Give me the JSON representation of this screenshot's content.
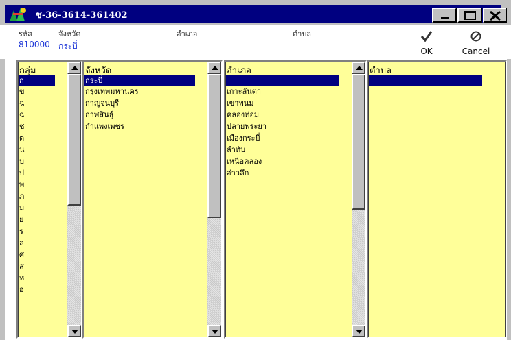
{
  "window": {
    "title": "ช-36-3614-361402"
  },
  "info": {
    "code_label": "รหัส",
    "code_value": "810000",
    "province_label": "จังหวัด",
    "province_value": "กระบี่",
    "district_label": "อำเภอ",
    "subdistrict_label": "ตำบล"
  },
  "actions": {
    "ok_label": "OK",
    "cancel_label": "Cancel"
  },
  "groups": {
    "header": "กลุ่ม",
    "selected": "ก",
    "items": [
      "ข",
      "ฉ",
      "ฉ",
      "ช",
      "ต",
      "น",
      "บ",
      "ป",
      "พ",
      "ภ",
      "ม",
      "ย",
      "ร",
      "ล",
      "ศ",
      "ส",
      "ห",
      "อ"
    ]
  },
  "provinces": {
    "header": "จังหวัด",
    "selected": "กระบี่",
    "items": [
      "กรุงเทพมหานคร",
      "กาญจนบุรี",
      "กาฬสินธุ์",
      "กำแพงเพชร"
    ]
  },
  "districts": {
    "header": "อำเภอ",
    "selected": "",
    "items": [
      "เกาะลันตา",
      "เขาพนม",
      "คลองท่อม",
      "ปลายพระยา",
      "เมืองกระบี่",
      "ลำทับ",
      "เหนือคลอง",
      "อ่าวลึก"
    ]
  },
  "subdistricts": {
    "header": "ตำบล",
    "selected": ""
  }
}
